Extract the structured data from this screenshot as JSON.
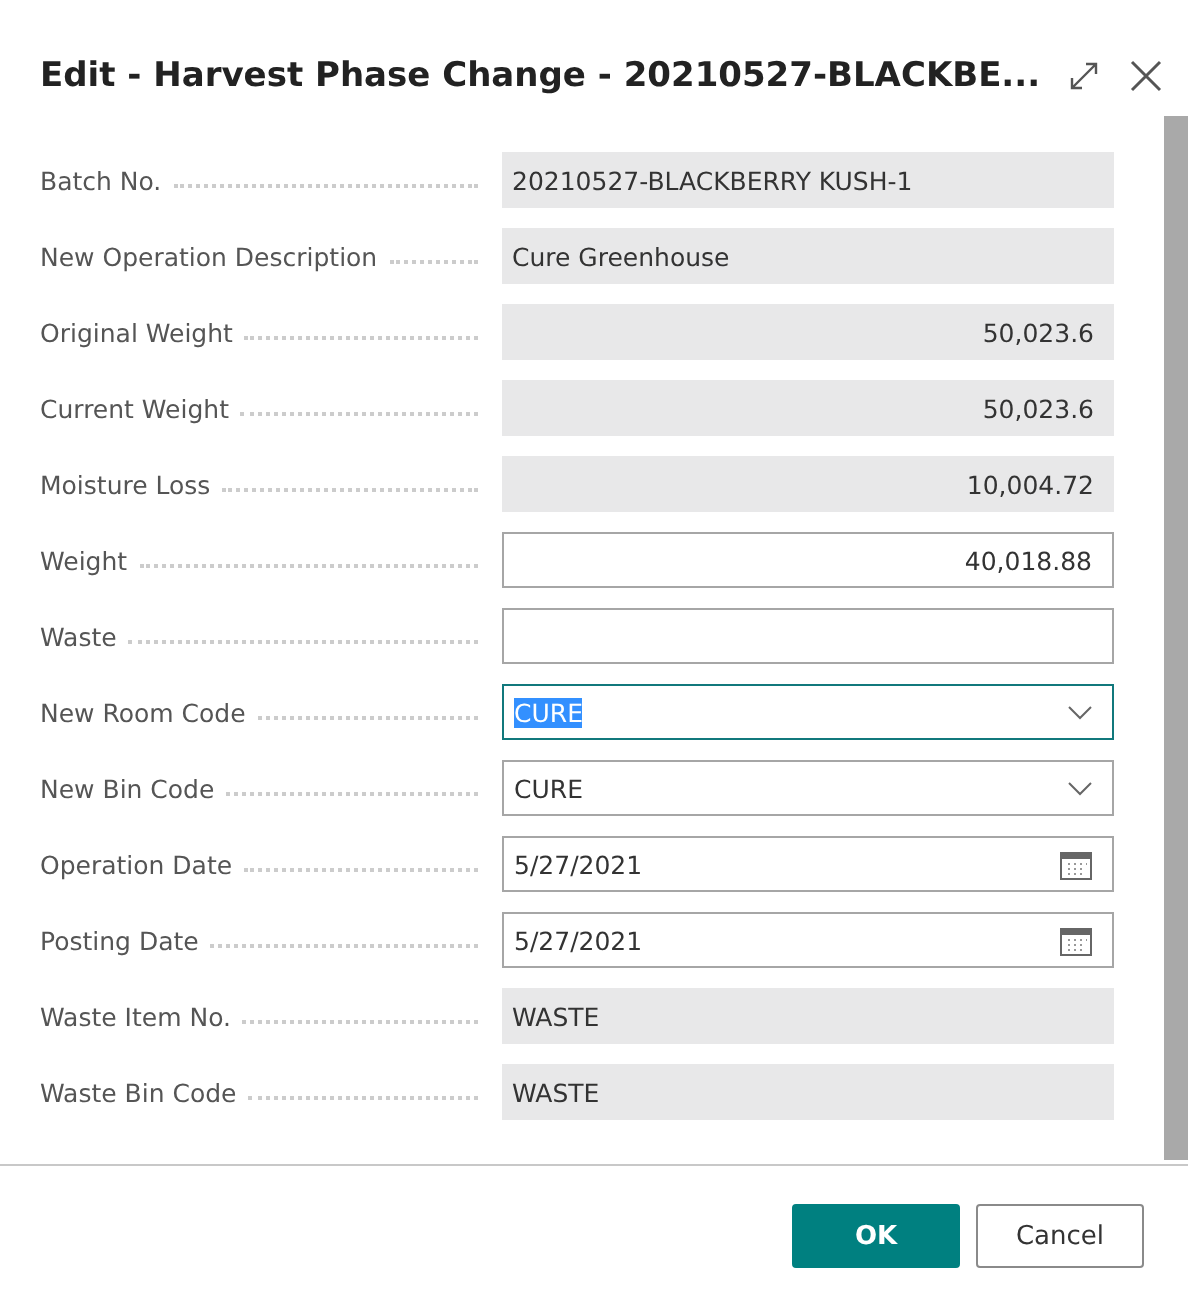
{
  "window": {
    "title": "Edit - Harvest Phase Change - 20210527-BLACKBE..."
  },
  "fields": [
    {
      "label": "Batch No.",
      "kind": "text",
      "editable": false,
      "focused": false,
      "value": "20210527-BLACKBERRY KUSH-1"
    },
    {
      "label": "New Operation Description",
      "kind": "text",
      "editable": false,
      "focused": false,
      "value": "Cure Greenhouse"
    },
    {
      "label": "Original Weight",
      "kind": "number",
      "editable": false,
      "focused": false,
      "value": "50,023.6"
    },
    {
      "label": "Current Weight",
      "kind": "number",
      "editable": false,
      "focused": false,
      "value": "50,023.6"
    },
    {
      "label": "Moisture Loss",
      "kind": "number",
      "editable": false,
      "focused": false,
      "value": "10,004.72"
    },
    {
      "label": "Weight",
      "kind": "number",
      "editable": true,
      "focused": false,
      "value": "40,018.88"
    },
    {
      "label": "Waste",
      "kind": "number",
      "editable": true,
      "focused": false
    },
    {
      "label": "New Room Code",
      "kind": "dropdown",
      "editable": true,
      "focused": true,
      "value": "CURE"
    },
    {
      "label": "New Bin Code",
      "kind": "dropdown",
      "editable": true,
      "focused": false,
      "value": "CURE"
    },
    {
      "label": "Operation Date",
      "kind": "date",
      "editable": true,
      "focused": false,
      "value": "5/27/2021"
    },
    {
      "label": "Posting Date",
      "kind": "date",
      "editable": true,
      "focused": false,
      "value": "5/27/2021"
    },
    {
      "label": "Waste Item No.",
      "kind": "text",
      "editable": false,
      "focused": false,
      "value": "WASTE"
    },
    {
      "label": "Waste Bin Code",
      "kind": "text",
      "editable": false,
      "focused": false,
      "value": "WASTE"
    }
  ],
  "buttons": [
    {
      "label": "OK",
      "kind": "primary"
    },
    {
      "label": "Cancel",
      "kind": "secondary"
    }
  ]
}
